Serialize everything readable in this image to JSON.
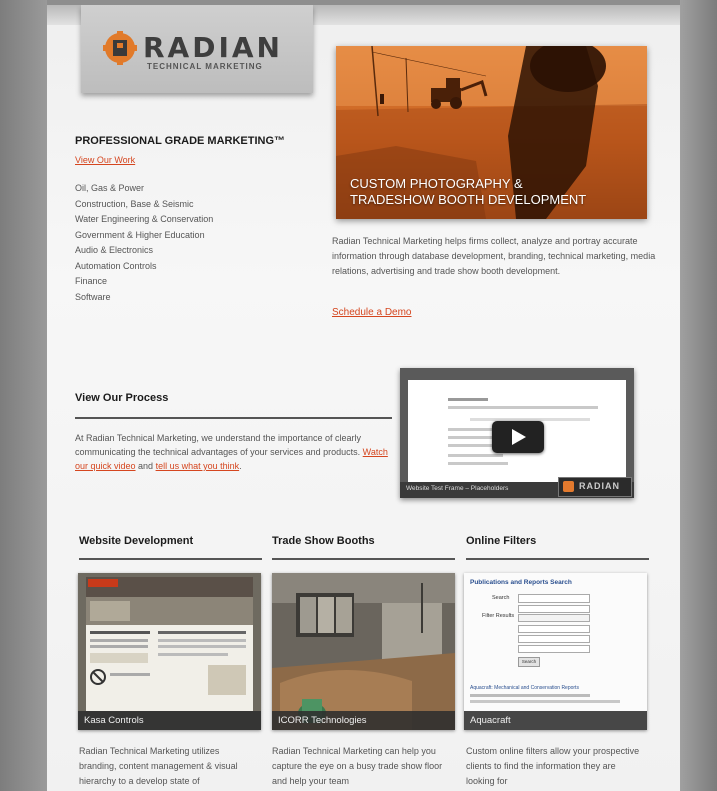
{
  "logo": {
    "wordmark": "RADIAN",
    "subtitle": "TECHNICAL MARKETING"
  },
  "intro": {
    "tagline": "PROFESSIONAL GRADE MARKETING™",
    "view_work_link": "View Our Work",
    "industries": [
      "Oil, Gas & Power",
      "Construction, Base & Seismic",
      "Water Engineering & Conservation",
      "Government & Higher Education",
      "Audio & Electronics",
      "Automation Controls",
      "Finance",
      "Software"
    ]
  },
  "hero": {
    "caption_line1": "CUSTOM PHOTOGRAPHY &",
    "caption_line2": "TRADESHOW BOOTH DEVELOPMENT",
    "description": "Radian Technical Marketing helps firms collect, analyze and portray accurate information through database development, branding, technical marketing, media relations, advertising and trade show booth development.",
    "demo_link": "Schedule a Demo"
  },
  "process": {
    "heading": "View Our Process",
    "text_start": "At Radian Technical Marketing, we understand the importance of clearly communicating the technical advantages of your services and products. ",
    "video_link": "Watch our quick video",
    "text_mid": " and ",
    "contact_link": "tell us what you think",
    "text_end": ".",
    "video_caption": "Website Test Frame – Placeholders",
    "video_badge": "RADIAN"
  },
  "sections": [
    {
      "heading": "Website Development",
      "thumb_caption": "Kasa Controls",
      "text": "Radian Technical Marketing utilizes branding, content management & visual hierarchy to a develop state of"
    },
    {
      "heading": "Trade Show Booths",
      "thumb_caption": "ICORR Technologies",
      "text": "Radian Technical Marketing can help you capture the eye on a busy trade show floor and help your team"
    },
    {
      "heading": "Online Filters",
      "thumb_caption": "Aquacraft",
      "text": "Custom online filters allow your prospective clients to find the information they are looking for"
    }
  ],
  "filters_preview": {
    "title": "Publications and Reports Search",
    "field1_label": "Search",
    "field2_label": "Filter Results",
    "search_button": "Search",
    "footer_text": "Aquacraft: Mechanical and Conservation Reports"
  },
  "colors": {
    "accent": "#d5461f",
    "hero_orange": "#d06a26",
    "text": "#555555",
    "heading": "#1b1b1b"
  }
}
